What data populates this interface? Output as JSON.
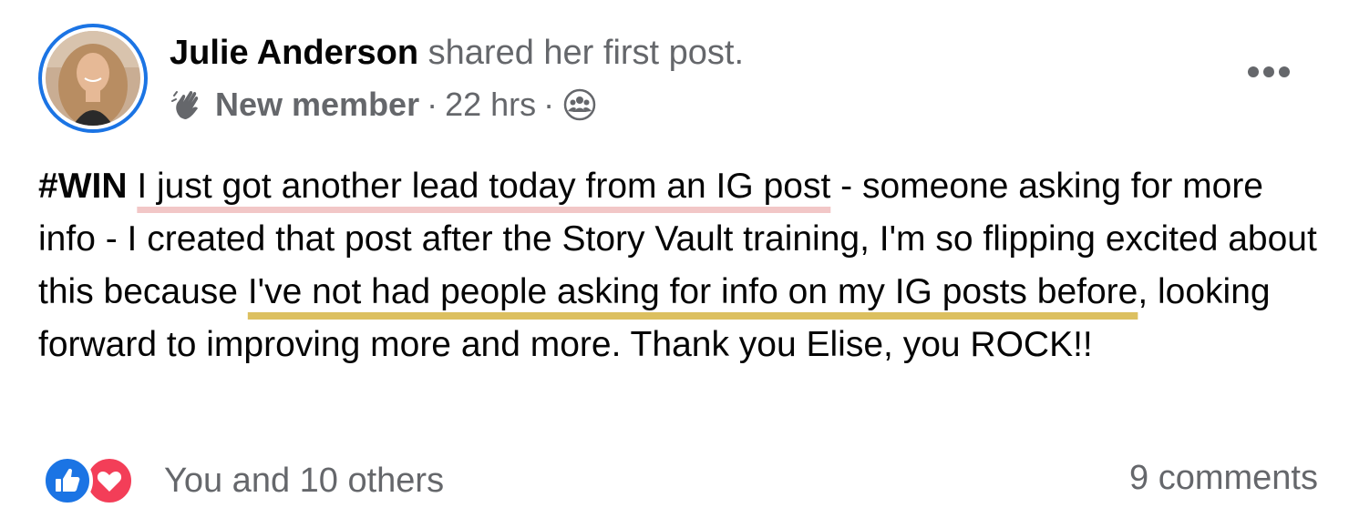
{
  "post": {
    "author": "Julie Anderson",
    "action": "shared her first post.",
    "badge": "New member",
    "time": "22 hrs",
    "separator": "·",
    "audience_icon": "group-audience-icon",
    "more_icon": "more-options-icon",
    "body": {
      "hashtag": "#WIN",
      "seg1": " ",
      "highlight1": "I just got another lead today from an IG post",
      "seg2": " - someone asking for more info - I created that post after the Story Vault training, I'm so flipping excited about this because ",
      "highlight2": "I've not had people asking for info on my IG posts before",
      "seg3": ", looking forward to improving more and more. Thank you Elise, you ROCK!!"
    },
    "reactions": {
      "icons": [
        "like-icon",
        "love-icon"
      ],
      "text": "You and 10 others"
    },
    "comments": "9 comments"
  },
  "colors": {
    "accent": "#1b74e4",
    "secondary_text": "#65676b",
    "highlight_pink": "#f2c7c7",
    "highlight_gold": "#dcc060",
    "love_red": "#f33e58"
  }
}
